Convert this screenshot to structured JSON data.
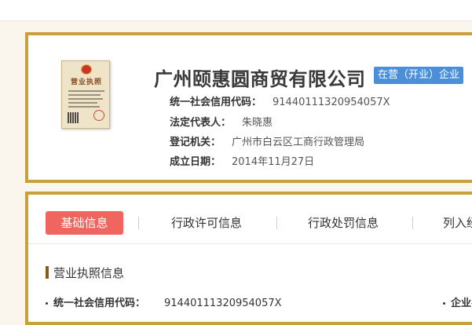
{
  "company": {
    "name": "广州颐惠圆商贸有限公司",
    "status": "在营（开业）企业",
    "status_color": "#4a8fd9"
  },
  "license_image": {
    "title": "营业执照"
  },
  "info": [
    {
      "label": "统一社会信用代码：",
      "value": "91440111320954057X"
    },
    {
      "label": "法定代表人：",
      "value": "朱晓惠"
    },
    {
      "label": "登记机关：",
      "value": "广州市白云区工商行政管理局"
    },
    {
      "label": "成立日期：",
      "value": "2014年11月27日"
    }
  ],
  "tabs": [
    {
      "label": "基础信息",
      "active": true
    },
    {
      "label": "行政许可信息",
      "active": false
    },
    {
      "label": "行政处罚信息",
      "active": false
    },
    {
      "label": "列入经",
      "active": false
    }
  ],
  "section": {
    "title": "营业执照信息",
    "rows": [
      {
        "label": "统一社会信用代码：",
        "value": "91440111320954057X"
      },
      {
        "label": "企业名",
        "value": ""
      }
    ]
  },
  "colors": {
    "border": "#c9a13a",
    "active_tab": "#f06560",
    "section_bar": "#8b5a16",
    "background": "#faf6ee"
  }
}
